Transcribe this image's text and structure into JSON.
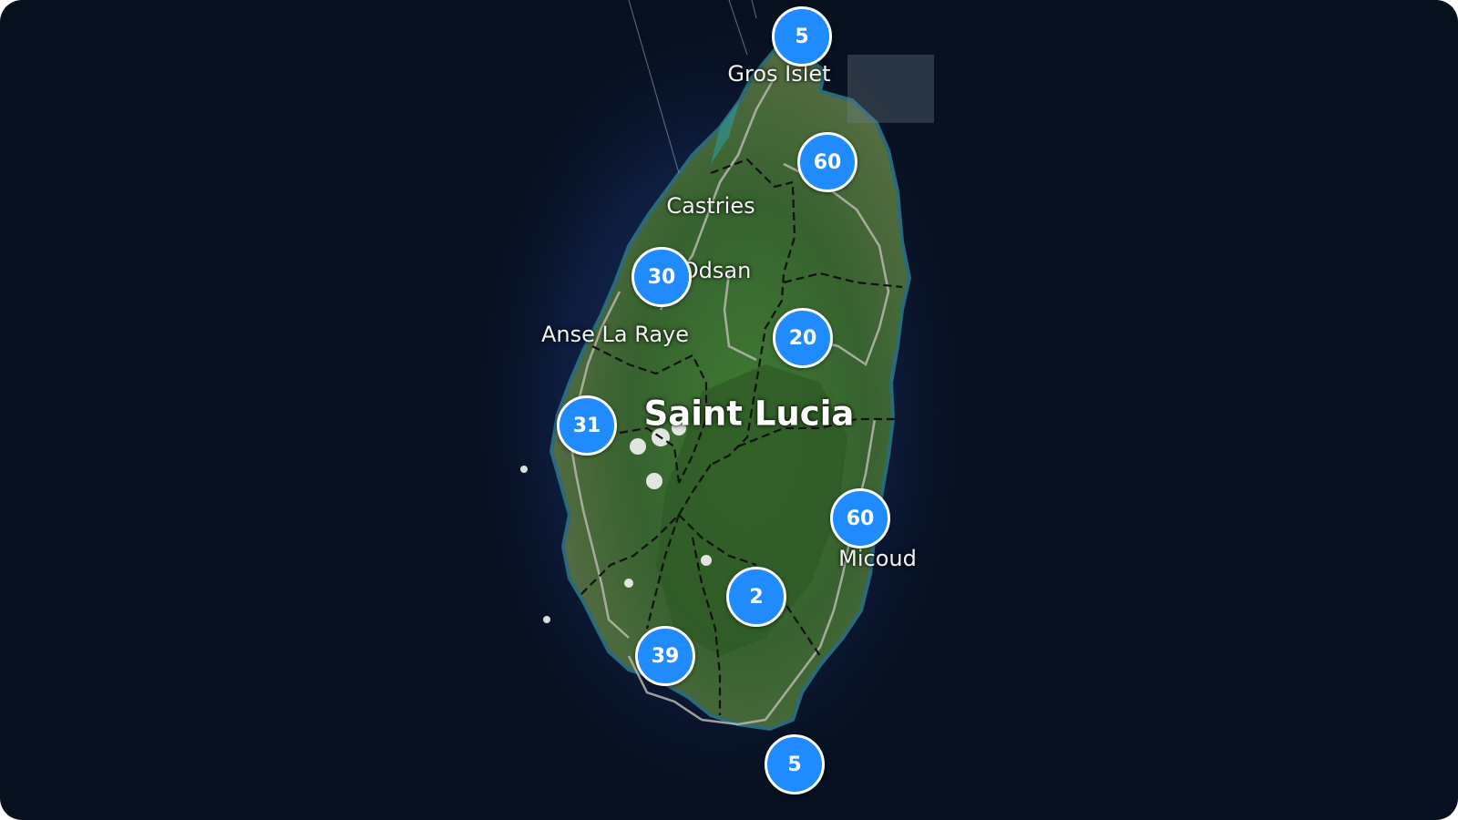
{
  "map": {
    "country_label": "Saint Lucia",
    "place_labels": {
      "gros_islet": "Gros Islet",
      "castries": "Castries",
      "odsan": "Odsan",
      "anse_la_raye": "Anse La Raye",
      "micoud": "Micoud"
    },
    "clusters": {
      "gros_islet": "5",
      "northeast": "60",
      "odsan": "30",
      "central": "20",
      "west": "31",
      "micoud": "60",
      "south_central": "2",
      "southwest": "39",
      "south_tip": "5"
    },
    "colors": {
      "ocean": "#07101f",
      "cluster_fill": "#1f8bff",
      "cluster_border": "#ffffff",
      "land": "#3d6a35"
    }
  }
}
